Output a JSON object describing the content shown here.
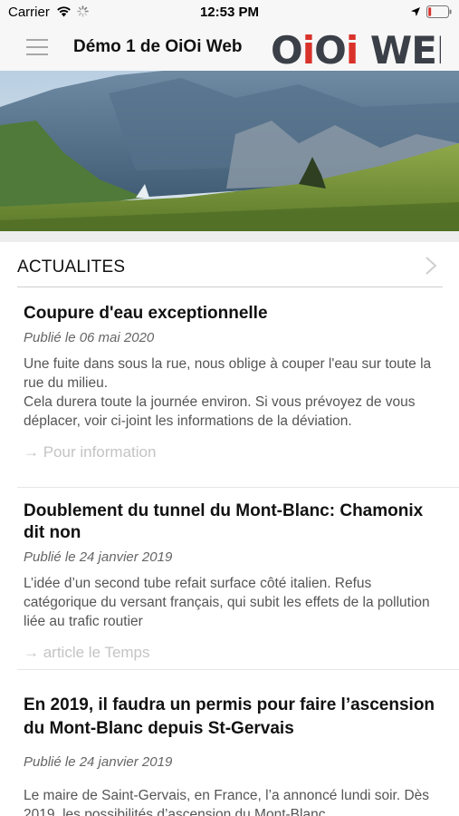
{
  "status_bar": {
    "carrier": "Carrier",
    "time": "12:53 PM"
  },
  "header": {
    "title": "Démo 1 de OiOi Web",
    "logo_text": "OiOi WEB",
    "colors": {
      "logo_dark": "#3b3f47",
      "logo_accent": "#d9322b"
    }
  },
  "section": {
    "title": "ACTUALITES"
  },
  "articles": [
    {
      "title": "Coupure d'eau exceptionnelle",
      "date": "Publié le 06 mai 2020",
      "body": "Une fuite dans sous la rue, nous oblige à couper l'eau sur toute la rue du milieu.\nCela durera toute la journée environ.  Si vous prévoyez de vous déplacer, voir ci-joint les informations de la déviation.",
      "link": "→ Pour information"
    },
    {
      "title": "Doublement du tunnel du Mont-Blanc: Chamonix dit non",
      "date": "Publié le 24 janvier 2019",
      "body": "L’idée d’un second tube refait surface côté italien. Refus catégorique du versant français, qui subit les effets de la pollution liée au trafic routier",
      "link": "→ article le Temps"
    },
    {
      "title": "En 2019, il faudra un permis pour faire l’ascension du Mont-Blanc depuis St-Gervais",
      "date": "Publié le 24 janvier 2019",
      "body": "Le maire de Saint-Gervais, en France, l’a annoncé lundi soir. Dès 2019, les possibilités d’ascension du Mont-Blanc"
    }
  ]
}
